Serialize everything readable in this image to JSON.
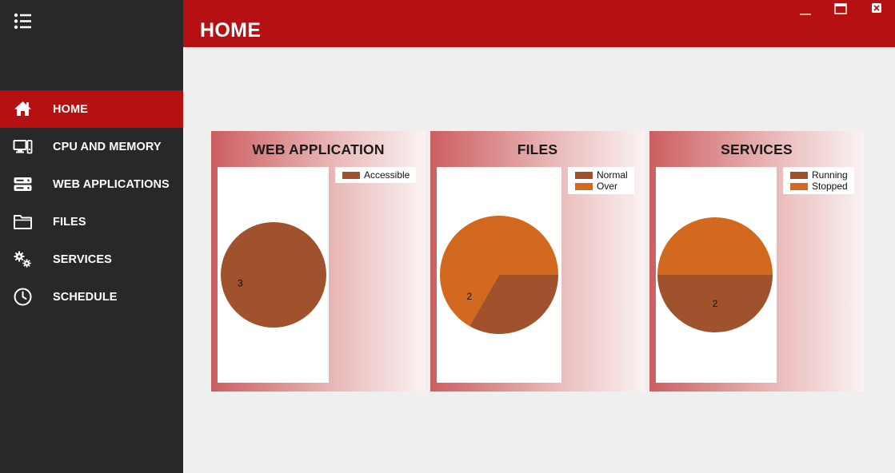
{
  "app": {
    "page_title": "HOME"
  },
  "window_controls": {
    "minimize_icon": "minimize-icon",
    "maximize_icon": "maximize-icon",
    "close_icon": "close-icon"
  },
  "sidebar": {
    "menu_icon": "hamburger-list-icon",
    "items": [
      {
        "label": "HOME",
        "icon": "home-icon",
        "active": true
      },
      {
        "label": "CPU AND MEMORY",
        "icon": "monitor-icon",
        "active": false
      },
      {
        "label": "WEB APPLICATIONS",
        "icon": "server-icon",
        "active": false
      },
      {
        "label": "FILES",
        "icon": "folder-icon",
        "active": false
      },
      {
        "label": "SERVICES",
        "icon": "gears-icon",
        "active": false
      },
      {
        "label": "SCHEDULE",
        "icon": "clock-icon",
        "active": false
      }
    ]
  },
  "colors": {
    "accent": "#b61112",
    "sidebar": "#282828",
    "brown": "#a0522d",
    "orange": "#d2691e"
  },
  "chart_data": [
    {
      "type": "pie",
      "title": "WEB APPLICATION",
      "categories": [
        "Accessible"
      ],
      "values": [
        3
      ],
      "colors": [
        "#a0522d"
      ],
      "legend": "top-right"
    },
    {
      "type": "pie",
      "title": "FILES",
      "categories": [
        "Normal",
        "Over"
      ],
      "values": [
        1,
        2
      ],
      "colors": [
        "#a0522d",
        "#d2691e"
      ],
      "legend": "top-right"
    },
    {
      "type": "pie",
      "title": "SERVICES",
      "categories": [
        "Running",
        "Stopped"
      ],
      "values": [
        2,
        2
      ],
      "colors": [
        "#a0522d",
        "#d2691e"
      ],
      "legend": "top-right"
    }
  ]
}
